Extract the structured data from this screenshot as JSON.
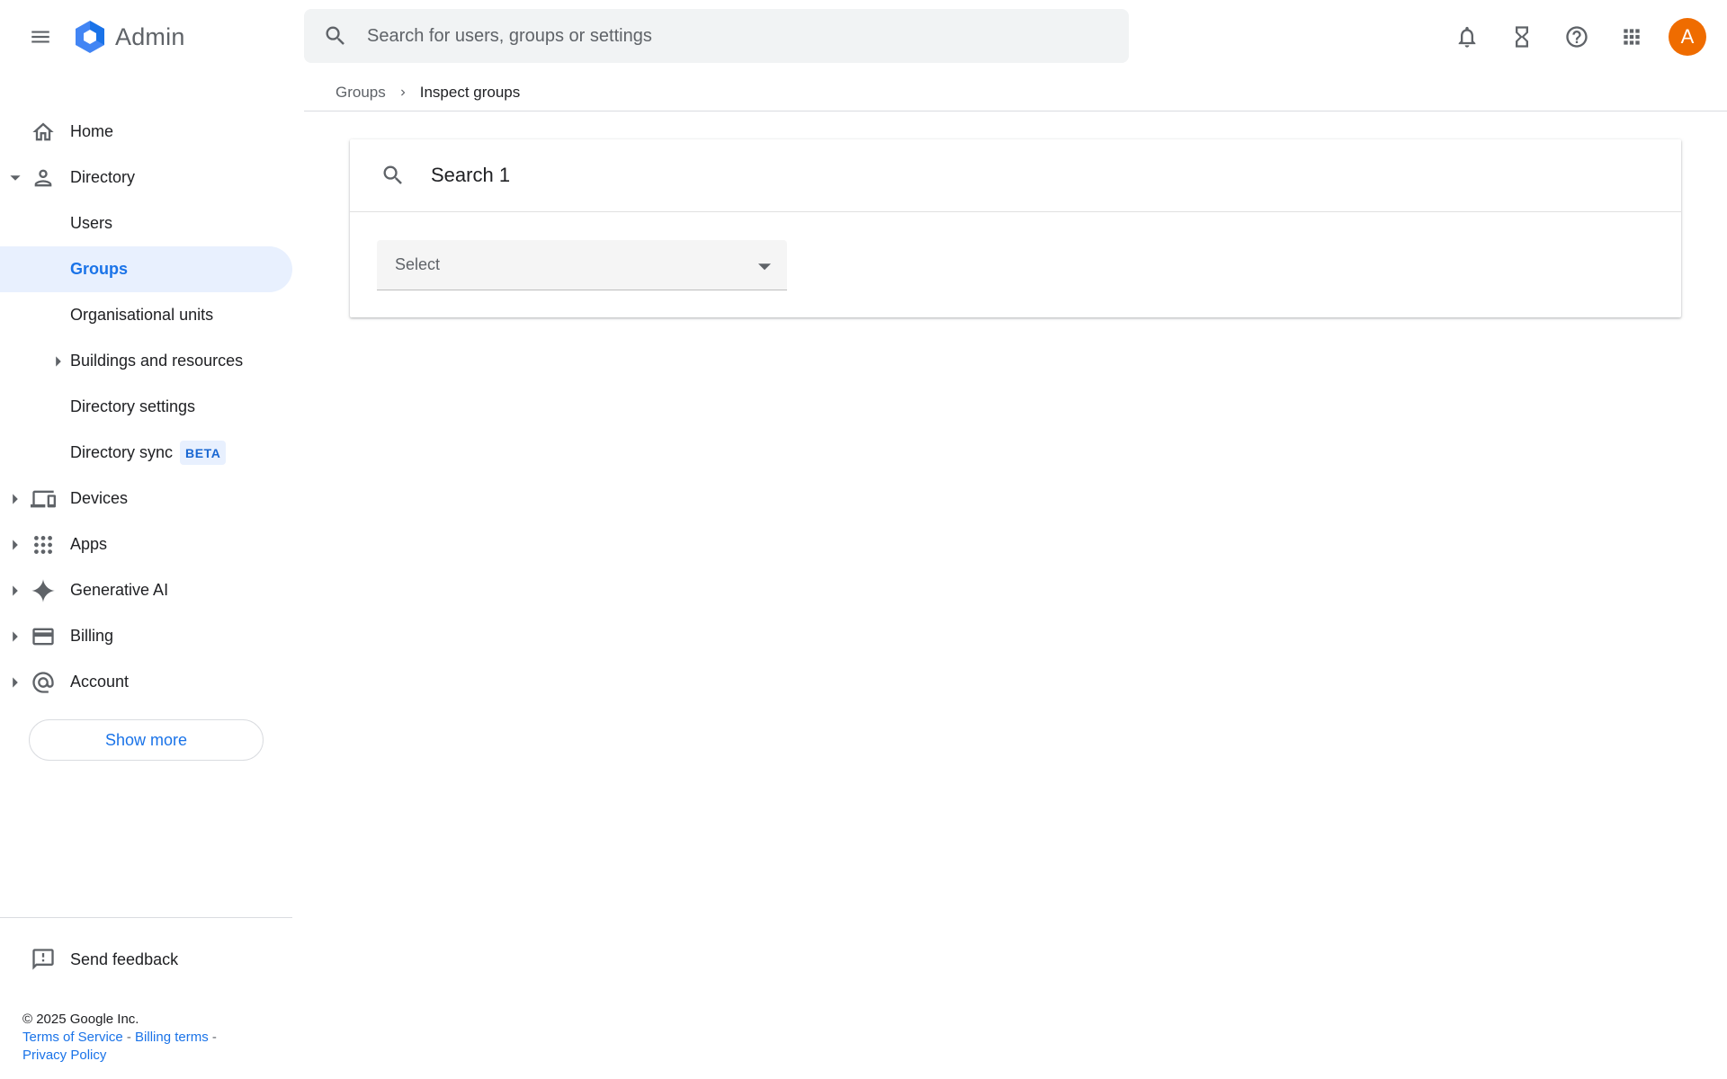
{
  "app": {
    "name": "Admin"
  },
  "colors": {
    "accent": "#1a73e8",
    "avatar_bg": "#ef6c00",
    "active_bg": "#e8f0fe"
  },
  "header": {
    "search_placeholder": "Search for users, groups or settings",
    "icons": [
      "notifications-icon",
      "hourglass-icon",
      "help-icon",
      "apps-grid-icon"
    ],
    "avatar_letter": "A"
  },
  "breadcrumb": {
    "parent": "Groups",
    "current": "Inspect groups"
  },
  "sidebar": {
    "items": [
      {
        "label": "Home",
        "icon": "home-icon"
      },
      {
        "label": "Directory",
        "icon": "person-icon",
        "expanded": true
      },
      {
        "label": "Users"
      },
      {
        "label": "Groups",
        "active": true
      },
      {
        "label": "Organisational units"
      },
      {
        "label": "Buildings and resources"
      },
      {
        "label": "Directory settings"
      },
      {
        "label": "Directory sync",
        "badge": "BETA"
      },
      {
        "label": "Devices",
        "icon": "devices-icon"
      },
      {
        "label": "Apps",
        "icon": "apps-icon"
      },
      {
        "label": "Generative AI",
        "icon": "sparkle-icon"
      },
      {
        "label": "Billing",
        "icon": "credit-card-icon"
      },
      {
        "label": "Account",
        "icon": "at-sign-icon"
      }
    ],
    "show_more": "Show more",
    "send_feedback": "Send feedback"
  },
  "footer": {
    "copyright": "© 2025 Google Inc.",
    "terms": "Terms of Service",
    "billing_terms": "Billing terms",
    "privacy": "Privacy Policy"
  },
  "main": {
    "card_title": "Search 1",
    "select_label": "Select"
  }
}
